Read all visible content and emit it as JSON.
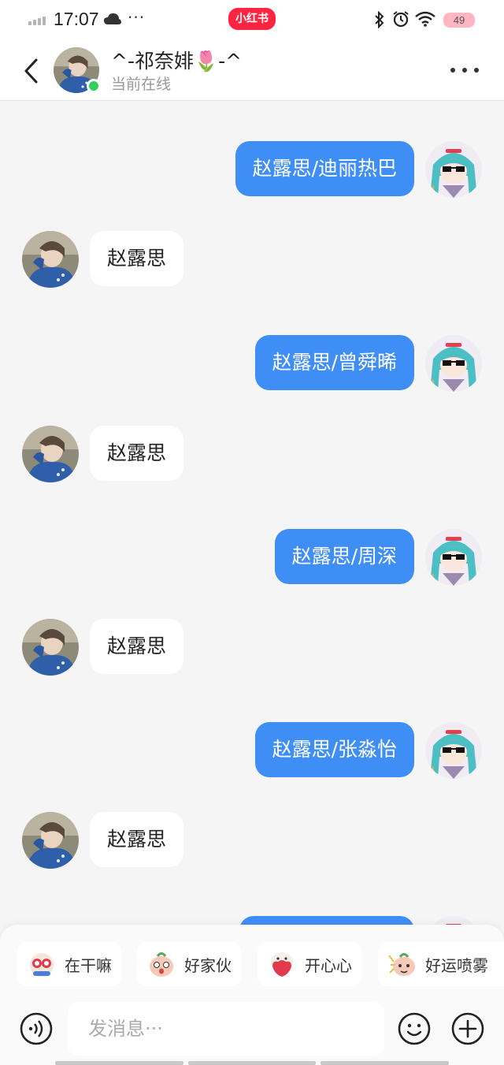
{
  "status_bar": {
    "time": "17:07",
    "dots": "···",
    "app_badge": "小红书",
    "battery": "49"
  },
  "header": {
    "name": "^-祁奈婔🌷-^",
    "status": "当前在线"
  },
  "messages": [
    {
      "side": "out",
      "text": "赵露思/迪丽热巴"
    },
    {
      "side": "in",
      "text": "赵露思"
    },
    {
      "side": "out",
      "text": "赵露思/曾舜晞"
    },
    {
      "side": "in",
      "text": "赵露思"
    },
    {
      "side": "out",
      "text": "赵露思/周深"
    },
    {
      "side": "in",
      "text": "赵露思"
    },
    {
      "side": "out",
      "text": "赵露思/张淼怡"
    },
    {
      "side": "in",
      "text": "赵露思"
    },
    {
      "side": "out",
      "text": ""
    }
  ],
  "quick_replies": [
    {
      "label": "在干嘛",
      "icon": "sticker-binoculars-icon"
    },
    {
      "label": "好家伙",
      "icon": "sticker-surprised-peach-icon"
    },
    {
      "label": "开心心",
      "icon": "sticker-heart-bear-icon"
    },
    {
      "label": "好运喷雾",
      "icon": "sticker-spray-peach-icon"
    }
  ],
  "composer": {
    "placeholder": "发消息···"
  },
  "colors": {
    "outgoing_bubble": "#3f8ef5",
    "incoming_bubble": "#ffffff",
    "online": "#2fd15a",
    "brand": "#ff2442"
  }
}
